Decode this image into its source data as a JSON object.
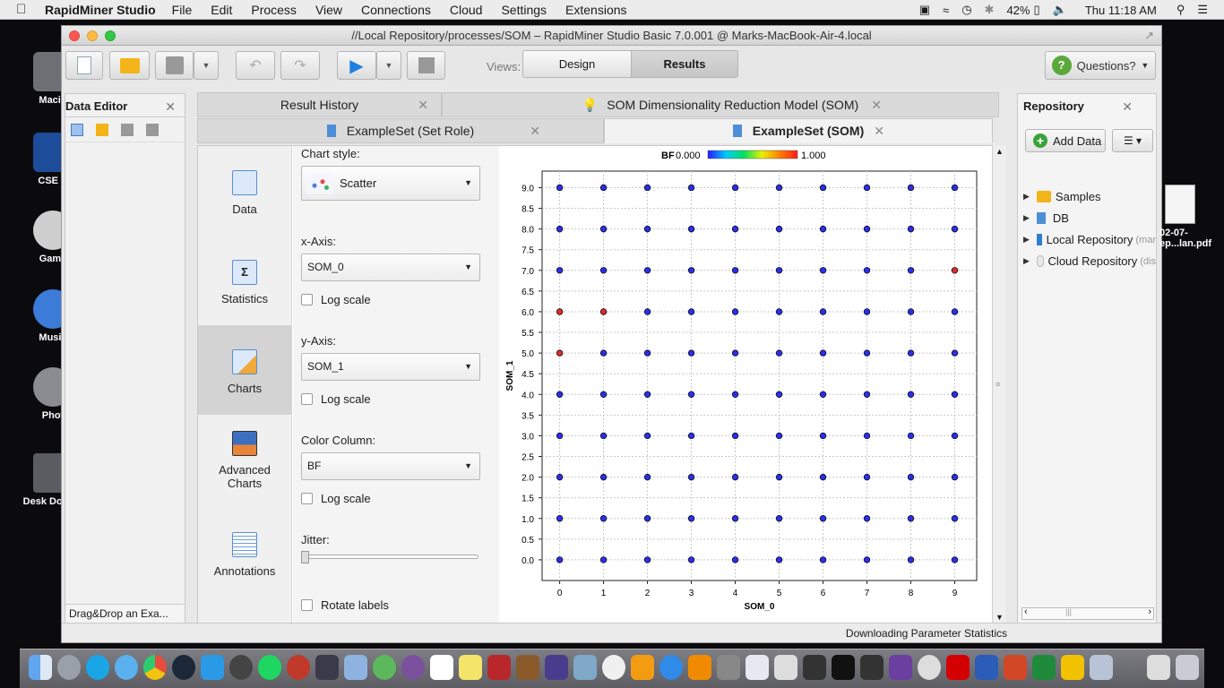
{
  "menubar": {
    "app_name": "RapidMiner Studio",
    "items": [
      "File",
      "Edit",
      "Process",
      "View",
      "Connections",
      "Cloud",
      "Settings",
      "Extensions"
    ],
    "battery": "42%",
    "clock": "Thu 11:18 AM"
  },
  "desktop": {
    "icons": [
      "Macin",
      "CSE A",
      "Game",
      "Music",
      "Phot",
      "Desk Docum"
    ],
    "file_name_line1": "02-07-",
    "file_name_line2": "ep...lan.pdf"
  },
  "window": {
    "title": "//Local Repository/processes/SOM – RapidMiner Studio Basic 7.0.001 @ Marks-MacBook-Air-4.local",
    "views_label": "Views:",
    "view_design": "Design",
    "view_results": "Results",
    "questions_label": "Questions?"
  },
  "data_editor": {
    "title": "Data Editor",
    "footer": "Drag&Drop an Exa..."
  },
  "tabs": {
    "row1": [
      "Result History",
      "SOM Dimensionality Reduction Model (SOM)"
    ],
    "row2": [
      "ExampleSet (Set Role)",
      "ExampleSet (SOM)"
    ],
    "active": "ExampleSet (SOM)"
  },
  "sidenav": {
    "items": [
      "Data",
      "Statistics",
      "Charts",
      "Advanced Charts",
      "Annotations"
    ],
    "selected": "Charts"
  },
  "chart_options": {
    "chart_style_label": "Chart style:",
    "chart_style": "Scatter",
    "x_axis_label": "x-Axis:",
    "x_axis": "SOM_0",
    "y_axis_label": "y-Axis:",
    "y_axis": "SOM_1",
    "color_column_label": "Color Column:",
    "color_column": "BF",
    "log_scale_label": "Log scale",
    "jitter_label": "Jitter:",
    "jitter_value": 0,
    "rotate_labels_label": "Rotate labels"
  },
  "chart_data": {
    "type": "scatter",
    "xlabel": "SOM_0",
    "ylabel": "SOM_1",
    "xlim": [
      -0.4,
      9.5
    ],
    "ylim": [
      -0.5,
      9.4
    ],
    "x_ticks": [
      "0",
      "1",
      "2",
      "3",
      "4",
      "5",
      "6",
      "7",
      "8",
      "9"
    ],
    "y_ticks": [
      "0.0",
      "0.5",
      "1.0",
      "1.5",
      "2.0",
      "2.5",
      "3.0",
      "3.5",
      "4.0",
      "4.5",
      "5.0",
      "5.5",
      "6.0",
      "6.5",
      "7.0",
      "7.5",
      "8.0",
      "8.5",
      "9.0"
    ],
    "grid": true,
    "legend": {
      "title": "BF",
      "min_label": "0.000",
      "max_label": "1.000",
      "colors": [
        "#2a1aff",
        "#00c8ff",
        "#00e060",
        "#e8f000",
        "#ff8000",
        "#ff1a1a"
      ]
    },
    "points_grid": {
      "x_values": [
        0,
        1,
        2,
        3,
        4,
        5,
        6,
        7,
        8,
        9
      ],
      "y_values": [
        0,
        1,
        2,
        3,
        4,
        5,
        6,
        7,
        8,
        9
      ],
      "BF": 0
    },
    "points_bf_1": [
      {
        "x": 0,
        "y": 5,
        "BF": 1
      },
      {
        "x": 0,
        "y": 6,
        "BF": 1
      },
      {
        "x": 1,
        "y": 6,
        "BF": 1
      },
      {
        "x": 9,
        "y": 7,
        "BF": 1
      }
    ],
    "point_colors": {
      "low": "#2a2ef0",
      "high": "#e02b2b"
    }
  },
  "repository": {
    "title": "Repository",
    "add_data": "Add Data",
    "items": [
      {
        "label": "Samples",
        "sub": ""
      },
      {
        "label": "DB",
        "sub": ""
      },
      {
        "label": "Local Repository",
        "sub": "(mar"
      },
      {
        "label": "Cloud Repository",
        "sub": "(dis"
      }
    ]
  },
  "status": {
    "text": "Downloading Parameter Statistics"
  }
}
